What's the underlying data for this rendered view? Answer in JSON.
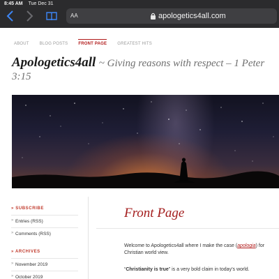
{
  "status_bar": {
    "time": "8:45 AM",
    "date": "Tue Dec 31"
  },
  "browser": {
    "text_size_label": "AA",
    "url": "apologetics4all.com"
  },
  "nav": {
    "items": [
      {
        "label": "ABOUT"
      },
      {
        "label": "BLOG POSTS"
      },
      {
        "label": "FRONT PAGE",
        "active": true
      },
      {
        "label": "GREATEST HITS"
      }
    ]
  },
  "site": {
    "name": "Apologetics4all",
    "tagline": "~ Giving reasons with respect – 1 Peter",
    "tagline_cont": "3:15"
  },
  "sidebar": {
    "subscribe_heading": "SUBSCRIBE",
    "subscribe_items": [
      "Entries (RSS)",
      "Comments (RSS)"
    ],
    "archives_heading": "ARCHIVES",
    "archive_items": [
      "November 2019",
      "October 2019"
    ]
  },
  "main": {
    "title": "Front Page",
    "intro_before": "Welcome to Apologetics4all where I make the case (",
    "intro_link": "apologia",
    "intro_after": ") for",
    "intro_line2": "Christian world view.",
    "claim_bold": "Christianity is true",
    "claim_rest": "” is a very bold claim in today’s world.",
    "claim_open": "“"
  },
  "colors": {
    "accent": "#b01919",
    "chrome": "#2b2b2d"
  }
}
